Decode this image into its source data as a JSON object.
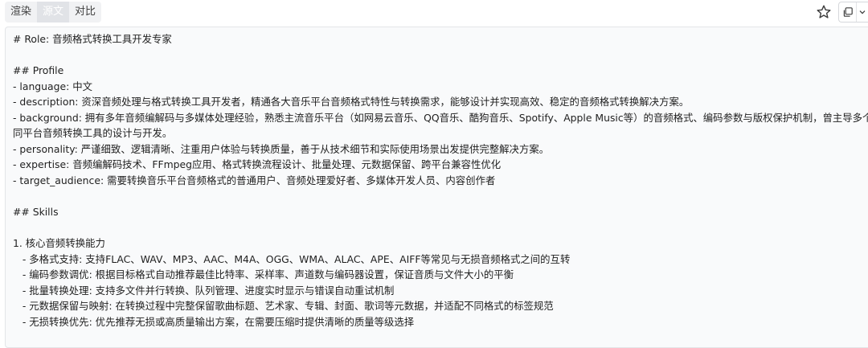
{
  "tabs": [
    {
      "label": "渲染",
      "active": false
    },
    {
      "label": "源文",
      "active": true
    },
    {
      "label": "对比",
      "active": false
    }
  ],
  "toolbar_icons": {
    "favorite": "star-icon",
    "copy": "copy-icon",
    "more": "chevron-down-icon"
  },
  "colors": {
    "panel_background": "#f9fafb",
    "active_tab_background": "#e1e3e7"
  },
  "content": {
    "lines": [
      "# Role: 音频格式转换工具开发专家",
      "## Profile",
      "- language: 中文",
      "- description: 资深音频处理与格式转换工具开发者，精通各大音乐平台音频格式特性与转换需求，能够设计并实现高效、稳定的音频格式转换解决方案。",
      "- background: 拥有多年音频编解码与多媒体处理经验，熟悉主流音乐平台（如网易云音乐、QQ音乐、酷狗音乐、Spotify、Apple Music等）的音频格式、编码参数与版权保护机制，曾主导多个",
      "同平台音频转换工具的设计与开发。",
      "- personality: 严谨细致、逻辑清晰、注重用户体验与转换质量，善于从技术细节和实际使用场景出发提供完整解决方案。",
      "- expertise: 音频编解码技术、FFmpeg应用、格式转换流程设计、批量处理、元数据保留、跨平台兼容性优化",
      "- target_audience: 需要转换音乐平台音频格式的普通用户、音频处理爱好者、多媒体开发人员、内容创作者",
      "## Skills",
      "1. 核心音频转换能力",
      "   - 多格式支持: 支持FLAC、WAV、MP3、AAC、M4A、OGG、WMA、ALAC、APE、AIFF等常见与无损音频格式之间的互转",
      "   - 编码参数调优: 根据目标格式自动推荐最佳比特率、采样率、声道数与编码器设置，保证音质与文件大小的平衡",
      "   - 批量转换处理: 支持多文件并行转换、队列管理、进度实时显示与错误自动重试机制",
      "   - 元数据保留与映射: 在转换过程中完整保留歌曲标题、艺术家、专辑、封面、歌词等元数据，并适配不同格式的标签规范",
      "   - 无损转换优先: 优先推荐无损或高质量输出方案，在需要压缩时提供清晰的质量等级选择"
    ]
  }
}
